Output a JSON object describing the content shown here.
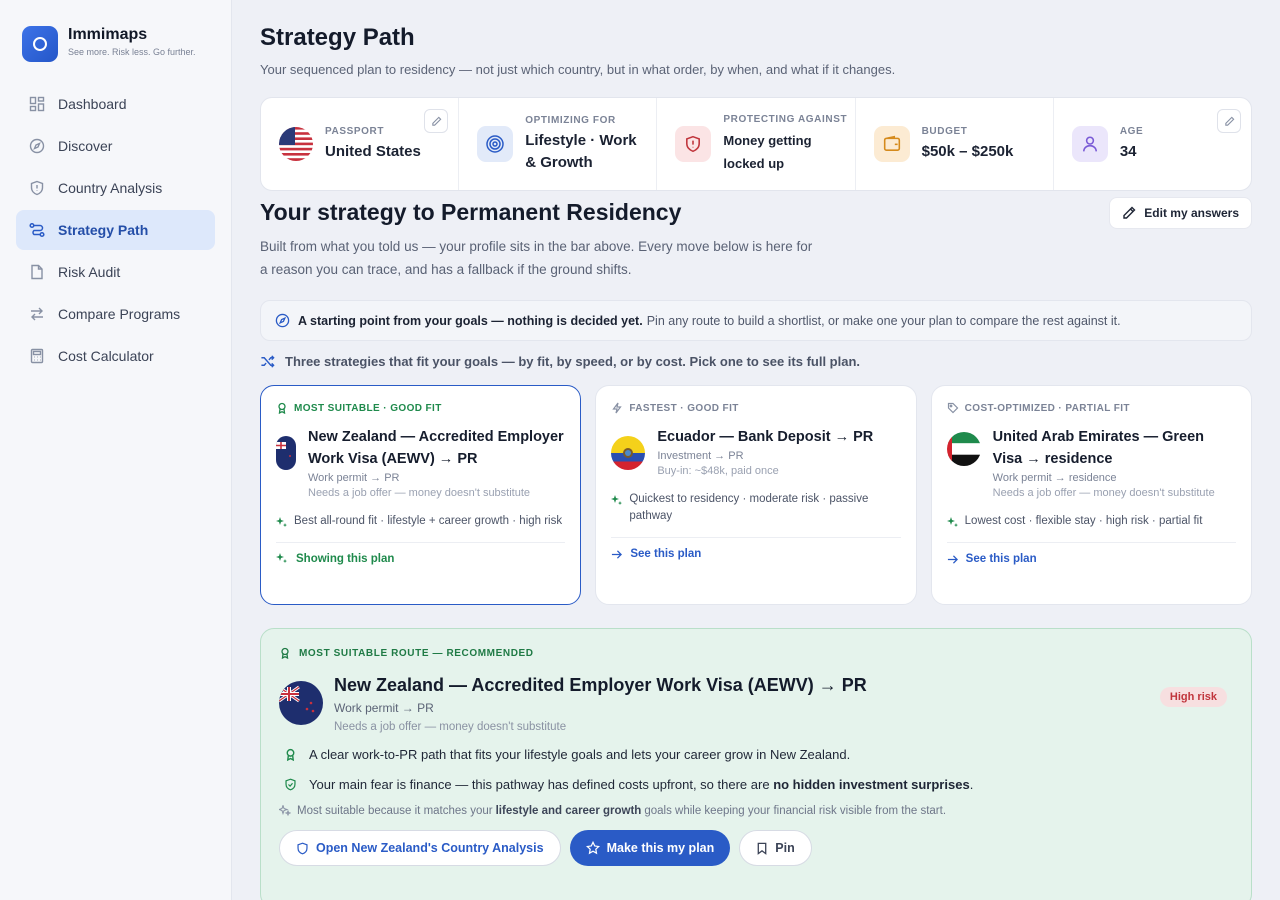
{
  "app": {
    "name": "Immimaps",
    "tagline": "See more. Risk less. Go further."
  },
  "sidebar": {
    "items": [
      {
        "label": "Dashboard",
        "icon": "grid-icon"
      },
      {
        "label": "Discover",
        "icon": "compass-icon"
      },
      {
        "label": "Country Analysis",
        "icon": "shield-icon"
      },
      {
        "label": "Strategy Path",
        "icon": "route-icon",
        "active": true
      },
      {
        "label": "Risk Audit",
        "icon": "document-icon"
      },
      {
        "label": "Compare Programs",
        "icon": "swap-icon"
      },
      {
        "label": "Cost Calculator",
        "icon": "calculator-icon"
      }
    ]
  },
  "header": {
    "title": "Strategy Path",
    "subtitle": "Your sequenced plan to residency — not just which country, but in what order, by when, and what if it changes."
  },
  "profile": {
    "passport": {
      "label": "PASSPORT",
      "value": "United States"
    },
    "optimizing": {
      "label": "OPTIMIZING FOR",
      "value_line1": "Lifestyle · Work",
      "value_line2": "& Growth"
    },
    "protecting": {
      "label": "PROTECTING AGAINST",
      "value_line1": "Money getting",
      "value_line2": "locked up"
    },
    "budget": {
      "label": "BUDGET",
      "value": "$50k – $250k"
    },
    "age": {
      "label": "AGE",
      "value": "34"
    }
  },
  "strategy": {
    "title": "Your strategy to Permanent Residency",
    "edit_label": "Edit my answers",
    "description": "Built from what you told us — your profile sits in the bar above. Every move below is here for a reason you can trace, and has a fallback if the ground shifts."
  },
  "notice": {
    "bold": "A starting point from your goals — nothing is decided yet.",
    "rest": "Pin any route to build a shortlist, or make one your plan to compare the rest against it."
  },
  "strategies_intro": "Three strategies that fit your goals — by fit, by speed, or by cost. Pick one to see its full plan.",
  "cards": [
    {
      "tag": "MOST SUITABLE · GOOD FIT",
      "title": "New Zealand — Accredited Employer Work Visa (AEWV) → PR",
      "type": "Work permit → PR",
      "note": "Needs a job offer — money doesn't substitute",
      "fit": "Best all-round fit · lifestyle + career growth · high risk",
      "link": "Showing this plan"
    },
    {
      "tag": "FASTEST · GOOD FIT",
      "title": "Ecuador — Bank Deposit → PR",
      "type": "Investment → PR",
      "note": "Buy-in: ~$48k, paid once",
      "fit": "Quickest to residency · moderate risk · passive pathway",
      "link": "See this plan"
    },
    {
      "tag": "COST-OPTIMIZED · PARTIAL FIT",
      "title": "United Arab Emirates — Green Visa → residence",
      "type": "Work permit → residence",
      "note": "Needs a job offer — money doesn't substitute",
      "fit": "Lowest cost · flexible stay · high risk · partial fit",
      "link": "See this plan"
    }
  ],
  "route": {
    "tag": "MOST SUITABLE ROUTE — RECOMMENDED",
    "title": "New Zealand — Accredited Employer Work Visa (AEWV) → PR",
    "type": "Work permit → PR",
    "note": "Needs a job offer — money doesn't substitute",
    "risk": "High risk",
    "reason1": "A clear work-to-PR path that fits your lifestyle goals and lets your career grow in New Zealand.",
    "reason2_a": "Your main fear is finance — this pathway has defined costs upfront, so there are",
    "reason2_b": "no hidden investment surprises",
    "reason2_c": ".",
    "why_a": "Most suitable because it matches your",
    "why_b": "lifestyle and career growth",
    "why_c": "goals while keeping your financial risk visible from the start.",
    "btn_analysis": "Open New Zealand's Country Analysis",
    "btn_plan": "Make this my plan",
    "btn_pin": "Pin"
  },
  "colors": {
    "accent": "#2a5bc6",
    "success": "#1f8a4c",
    "danger": "#c0353c"
  }
}
